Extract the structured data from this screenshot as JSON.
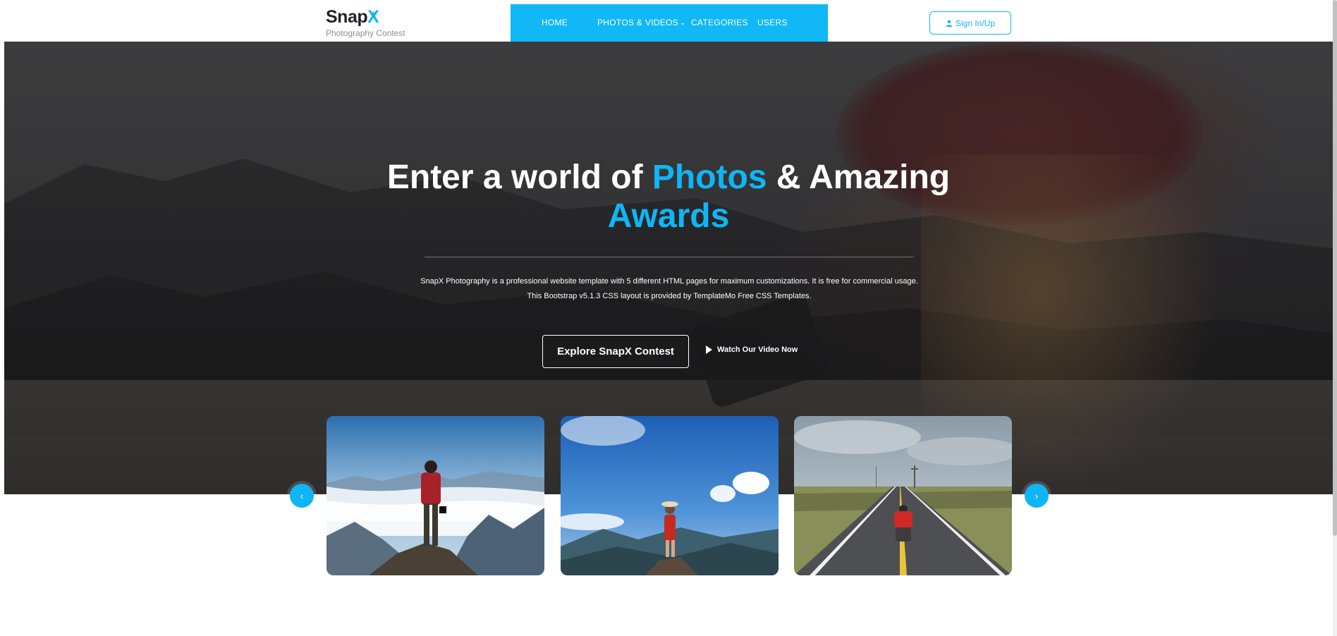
{
  "brand": {
    "name_prefix": "Snap",
    "name_accent": "X",
    "tagline": "Photography Contest",
    "accent_color": "#10b5f5"
  },
  "nav": {
    "items": [
      {
        "label": "HOME"
      },
      {
        "label": "PHOTOS & VIDEOS",
        "has_dropdown": true,
        "dropdown_icon": "chevron-down-icon"
      },
      {
        "label": "CATEGORIES"
      },
      {
        "label": "USERS"
      }
    ],
    "background_color": "#10b8f7"
  },
  "auth": {
    "signin_label": "Sign In/Up",
    "icon": "user-icon"
  },
  "hero": {
    "title_part1": "Enter a world of ",
    "title_accent1": "Photos",
    "title_part2": " & Amazing",
    "title_accent2": "Awards",
    "description": "SnapX Photography is a professional website template with 5 different HTML pages for maximum customizations. It is free for commercial usage. This Bootstrap v5.1.3 CSS layout is provided by TemplateMo Free CSS Templates.",
    "explore_label": "Explore SnapX Contest",
    "watch_label": "Watch Our Video Now",
    "watch_icon": "play-icon"
  },
  "carousel": {
    "prev_icon": "chevron-left-icon",
    "prev_glyph": "‹",
    "next_icon": "chevron-right-icon",
    "next_glyph": "›",
    "items": [
      {
        "subject": "hiker-on-mountain-peak"
      },
      {
        "subject": "woman-on-mountain-top"
      },
      {
        "subject": "photographer-on-road"
      }
    ]
  }
}
